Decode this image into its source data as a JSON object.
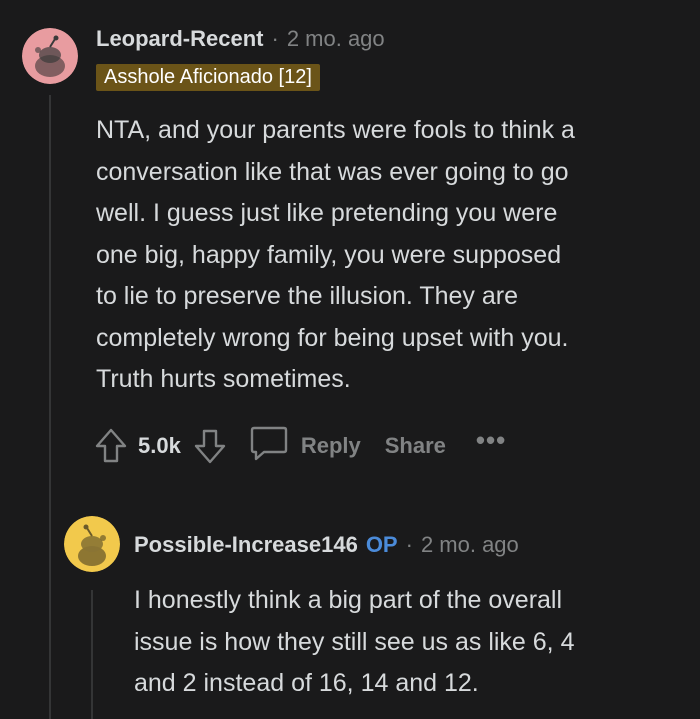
{
  "comment": {
    "author": "Leopard-Recent",
    "separator": "·",
    "time": "2 mo. ago",
    "flair": "Asshole Aficionado [12]",
    "lines": [
      "NTA, and your parents were fools to think a",
      "conversation like that was ever going to go",
      "well. I guess just like pretending you were",
      "one big, happy family, you were supposed",
      "to lie to preserve the illusion. They are",
      "completely wrong for being upset with you.",
      "Truth hurts sometimes."
    ],
    "vote_count": "5.0k",
    "reply_label": "Reply",
    "share_label": "Share",
    "more_label": "•••",
    "avatar_color": "#e89ca0"
  },
  "reply": {
    "author": "Possible-Increase146",
    "op_badge": "OP",
    "separator": "·",
    "time": "2 mo. ago",
    "lines": [
      "I honestly think a big part of the overall",
      "issue is how they still see us as like 6, 4",
      "and 2 instead of 16, 14 and 12."
    ],
    "avatar_color": "#f2c94c"
  }
}
